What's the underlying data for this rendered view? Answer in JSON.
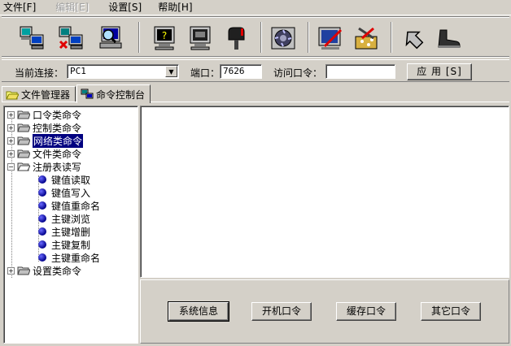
{
  "menubar": {
    "items": [
      "文件[F]",
      "编辑[E]",
      "设置[S]",
      "帮助[H]"
    ]
  },
  "toolbar": {
    "buttons": [
      "computer-connect-icon",
      "computer-disconnect-icon",
      "computer-search-icon",
      "monitor-help-icon",
      "monitor-screen-icon",
      "mailbox-icon",
      "settings-disc-icon",
      "edit-panel-icon",
      "tools-icon",
      "back-arrow-icon",
      "boot-icon"
    ]
  },
  "connection": {
    "current_label": "当前连接：",
    "current_value": "PC1",
    "port_label": "端口：",
    "port_value": "7626",
    "password_label": "访问口令：",
    "password_value": "",
    "apply_label": "应 用 [S]"
  },
  "tabs": [
    {
      "label": "文件管理器"
    },
    {
      "label": "命令控制台"
    }
  ],
  "tree": {
    "items": [
      {
        "label": "口令类命令"
      },
      {
        "label": "控制类命令"
      },
      {
        "label": "网络类命令"
      },
      {
        "label": "文件类命令"
      },
      {
        "label": "注册表读写"
      },
      {
        "label": "键值读取"
      },
      {
        "label": "键值写入"
      },
      {
        "label": "键值重命名"
      },
      {
        "label": "主键浏览"
      },
      {
        "label": "主键增删"
      },
      {
        "label": "主键复制"
      },
      {
        "label": "主键重命名"
      },
      {
        "label": "设置类命令"
      }
    ]
  },
  "commands": {
    "buttons": [
      "系统信息",
      "开机口令",
      "缓存口令",
      "其它口令"
    ]
  },
  "colors": {
    "window_bg": "#d4d0c8",
    "selection": "#000080"
  }
}
